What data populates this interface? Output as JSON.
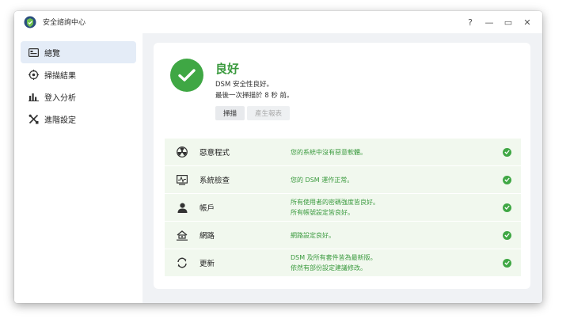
{
  "window": {
    "title": "安全諮詢中心",
    "controls": [
      "?",
      "—",
      "▭",
      "✕"
    ]
  },
  "sidebar": {
    "items": [
      {
        "label": "總覽",
        "icon": "overview-icon",
        "active": true
      },
      {
        "label": "掃描結果",
        "icon": "scan-results-icon",
        "active": false
      },
      {
        "label": "登入分析",
        "icon": "login-analysis-icon",
        "active": false
      },
      {
        "label": "進階設定",
        "icon": "advanced-settings-icon",
        "active": false
      }
    ]
  },
  "status": {
    "title": "良好",
    "line1": "DSM 安全性良好。",
    "line2": "最後一次掃描於 8 秒 前。",
    "scan_button": "掃描",
    "report_button": "產生報表",
    "color": "#3fa744"
  },
  "checks": [
    {
      "name": "惡意程式",
      "icon": "radiation-icon",
      "desc": [
        "您的系統中沒有惡意軟體。"
      ]
    },
    {
      "name": "系統檢查",
      "icon": "system-monitor-icon",
      "desc": [
        "您的 DSM 運作正常。"
      ]
    },
    {
      "name": "帳戶",
      "icon": "user-icon",
      "desc": [
        "所有使用者的密碼強度皆良好。",
        "所有帳號設定皆良好。"
      ]
    },
    {
      "name": "網路",
      "icon": "network-home-icon",
      "desc": [
        "網路設定良好。"
      ]
    },
    {
      "name": "更新",
      "icon": "refresh-icon",
      "desc": [
        "DSM 及所有套件皆為最新版。",
        "依然有部份設定建議修改。"
      ]
    }
  ]
}
